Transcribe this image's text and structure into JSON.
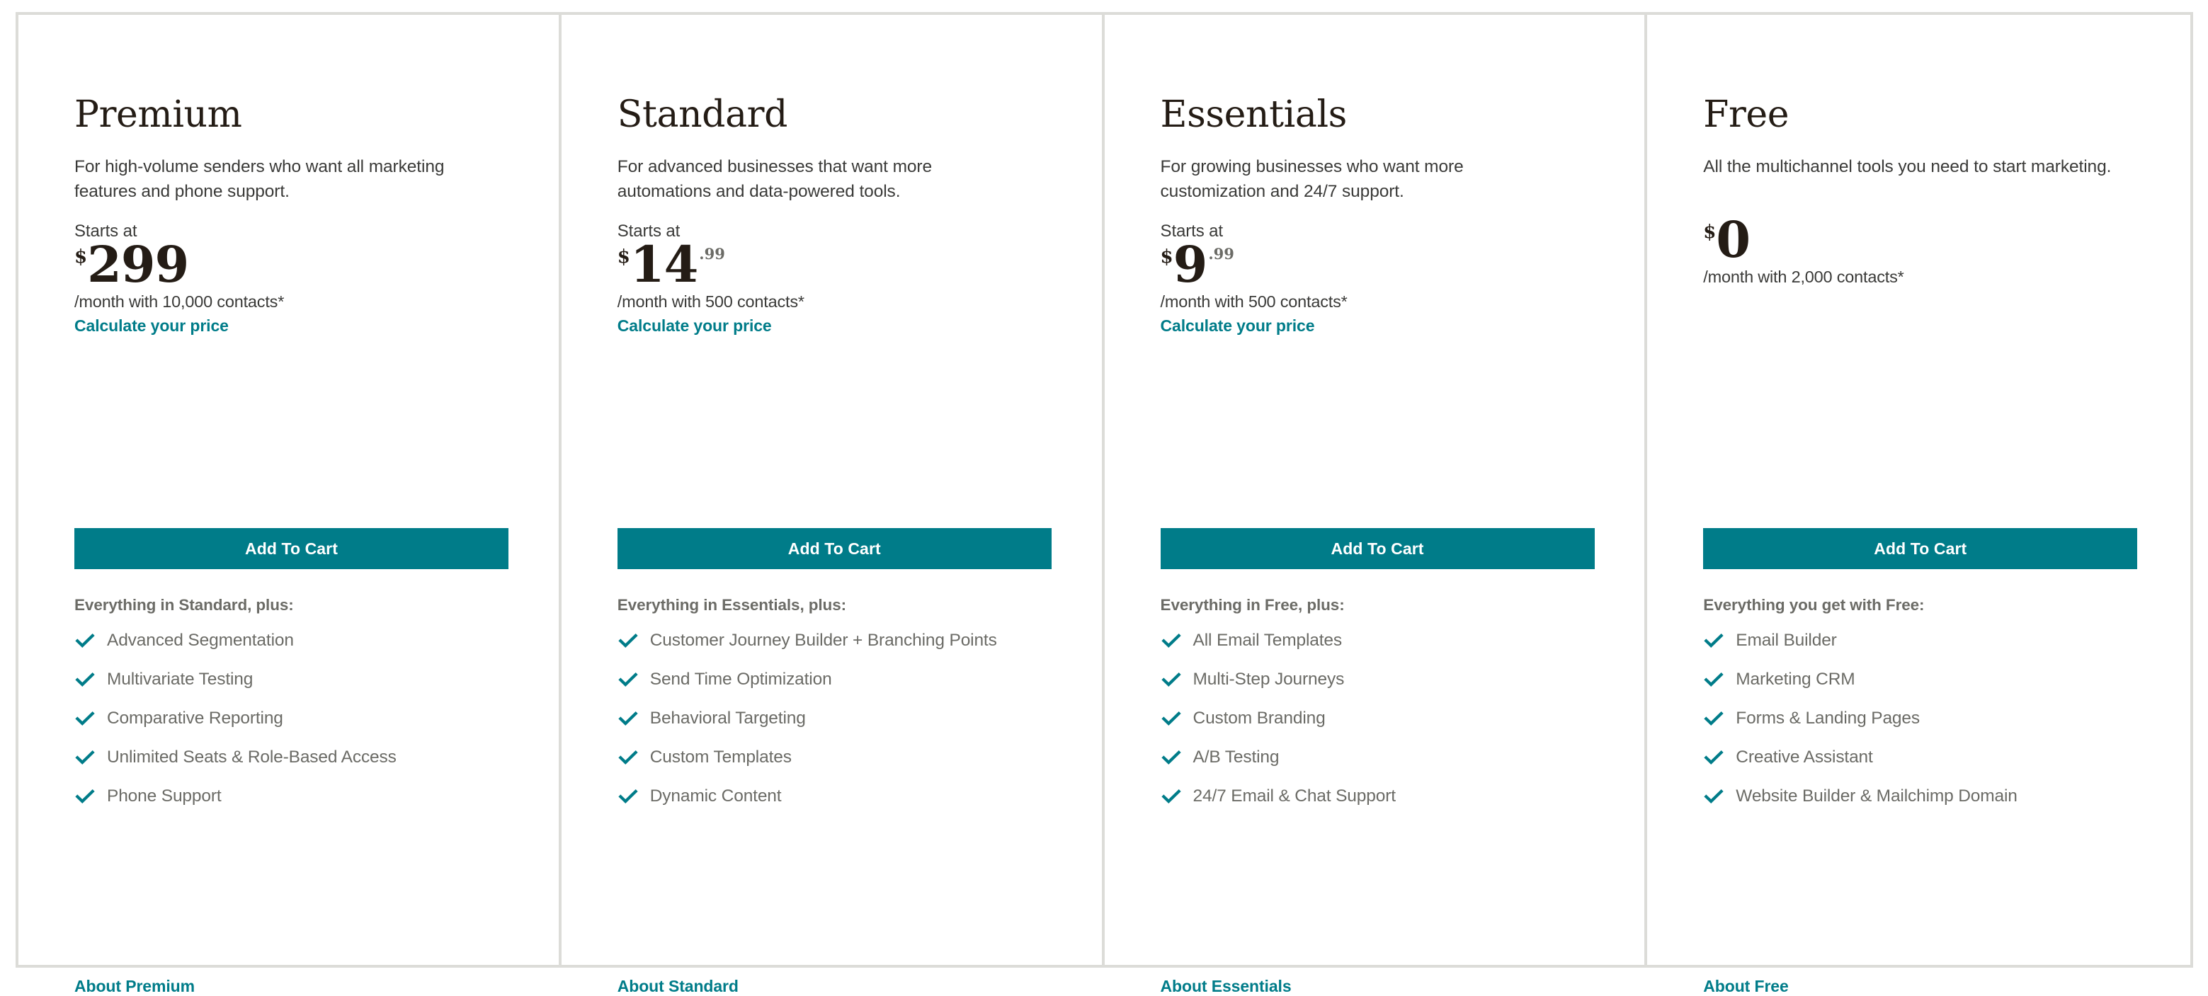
{
  "theme": {
    "accent_teal": "#007c89",
    "border_gray": "#dcdcd8",
    "text_dark": "#241c15",
    "text_body": "#3a3a38",
    "text_muted": "#6b6b66",
    "button_text": "#ffffff"
  },
  "icons": {
    "check": "check-icon"
  },
  "plans": [
    {
      "name": "Premium",
      "description": "For high-volume senders who want all marketing features and phone support.",
      "starts_at_label": "Starts at",
      "has_starts_at": true,
      "currency": "$",
      "amount": "299",
      "cents": "",
      "has_cents": false,
      "price_note": "/month with 10,000 contacts*",
      "calculate_link": "Calculate your price",
      "has_calculate_link": true,
      "cta_label": "Add To Cart",
      "features_heading": "Everything in Standard, plus:",
      "features": [
        "Advanced Segmentation",
        "Multivariate Testing",
        "Comparative Reporting",
        "Unlimited Seats & Role-Based Access",
        "Phone Support"
      ],
      "about_link": "About Premium"
    },
    {
      "name": "Standard",
      "description": "For advanced businesses that want more automations and data-powered tools.",
      "starts_at_label": "Starts at",
      "has_starts_at": true,
      "currency": "$",
      "amount": "14",
      "cents": ".99",
      "has_cents": true,
      "price_note": "/month with 500 contacts*",
      "calculate_link": "Calculate your price",
      "has_calculate_link": true,
      "cta_label": "Add To Cart",
      "features_heading": "Everything in Essentials, plus:",
      "features": [
        "Customer Journey Builder + Branching Points",
        "Send Time Optimization",
        "Behavioral Targeting",
        "Custom Templates",
        "Dynamic Content"
      ],
      "about_link": "About Standard"
    },
    {
      "name": "Essentials",
      "description": "For growing businesses who want more customization and 24/7 support.",
      "starts_at_label": "Starts at",
      "has_starts_at": true,
      "currency": "$",
      "amount": "9",
      "cents": ".99",
      "has_cents": true,
      "price_note": "/month with 500 contacts*",
      "calculate_link": "Calculate your price",
      "has_calculate_link": true,
      "cta_label": "Add To Cart",
      "features_heading": "Everything in Free, plus:",
      "features": [
        "All Email Templates",
        "Multi-Step Journeys",
        "Custom Branding",
        "A/B Testing",
        "24/7 Email & Chat Support"
      ],
      "about_link": "About Essentials"
    },
    {
      "name": "Free",
      "description": "All the multichannel tools you need to start marketing.",
      "starts_at_label": "",
      "has_starts_at": false,
      "currency": "$",
      "amount": "0",
      "cents": "",
      "has_cents": false,
      "price_note": "/month with 2,000 contacts*",
      "calculate_link": "",
      "has_calculate_link": false,
      "cta_label": "Add To Cart",
      "features_heading": "Everything you get with Free:",
      "features": [
        "Email Builder",
        "Marketing CRM",
        "Forms & Landing Pages",
        "Creative Assistant",
        "Website Builder & Mailchimp Domain"
      ],
      "about_link": "About Free"
    }
  ]
}
